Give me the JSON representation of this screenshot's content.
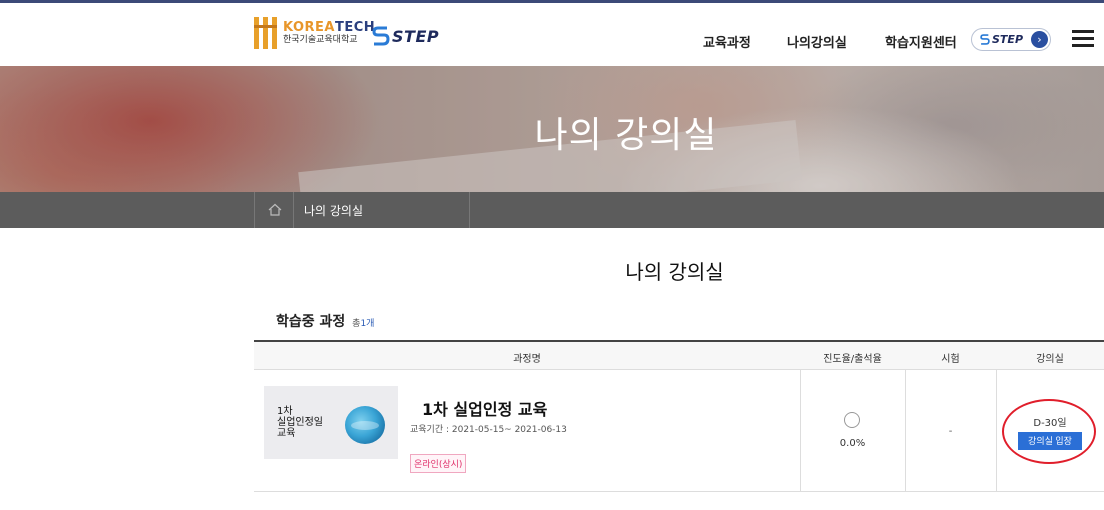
{
  "header": {
    "logo_en_1": "KOREA",
    "logo_en_2": "TECH",
    "logo_ko": "한국기술교육대학교",
    "step_logo": "STEP",
    "nav": [
      "교육과정",
      "나의강의실",
      "학습지원센터"
    ],
    "step_button": "STEP"
  },
  "banner": {
    "title": "나의 강의실"
  },
  "breadcrumb": {
    "label": "나의 강의실"
  },
  "page": {
    "title": "나의 강의실"
  },
  "section": {
    "title": "학습중 과정",
    "count_label": "총",
    "count_value": "1개"
  },
  "table": {
    "headers": {
      "course": "과정명",
      "progress": "진도율/출석율",
      "exam": "시험",
      "room": "강의실"
    },
    "rows": [
      {
        "thumb_text": "1차\n실업인정일\n교육",
        "name": "1차 실업인정 교육",
        "period": "교육기간 : 2021-05-15~ 2021-06-13",
        "badge": "온라인(상시)",
        "progress": "0.0%",
        "exam": "-",
        "dday": "D-30일",
        "enter_label": "강의실 입장"
      }
    ]
  },
  "colors": {
    "accent": "#2b6fd6",
    "highlight_ring": "#e01e2b",
    "badge": "#e0306a"
  }
}
